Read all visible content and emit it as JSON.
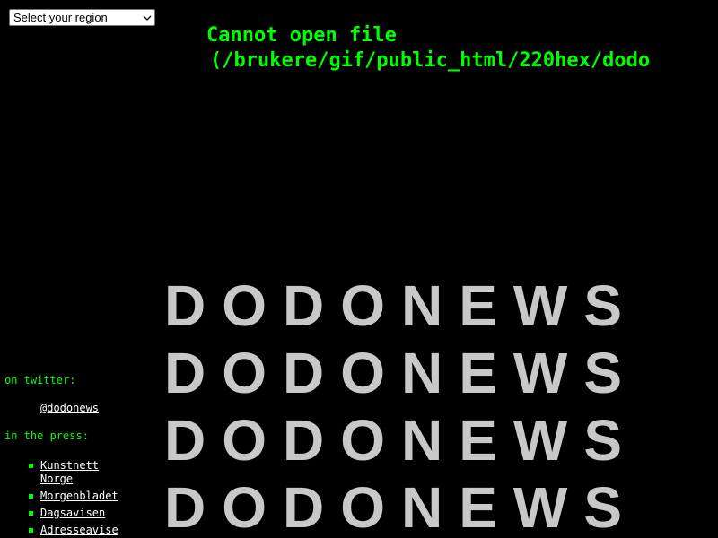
{
  "region_select": {
    "selected": "Select your region",
    "icon": "chevron-down-icon"
  },
  "error": {
    "line1": "Cannot open file",
    "line2": "(/brukere/gif/public_html/220hex/dodo"
  },
  "sidebar": {
    "twitter_heading": "on twitter:",
    "twitter_handle": "@dodonews",
    "press_heading": "in the press:",
    "press_items": [
      {
        "label": "Kunstnett Norge"
      },
      {
        "label": "Morgenbladet"
      },
      {
        "label": "Dagsavisen"
      },
      {
        "label": "Adresseavisen"
      }
    ]
  },
  "banner": {
    "rows": [
      "DODONEWS",
      "DODONEWS",
      "DODONEWS",
      "DODONEWS"
    ]
  },
  "colors": {
    "background": "#000000",
    "accent_green": "#00ff00",
    "banner_gray": "#c8c8c8",
    "link_white": "#ffffff"
  }
}
